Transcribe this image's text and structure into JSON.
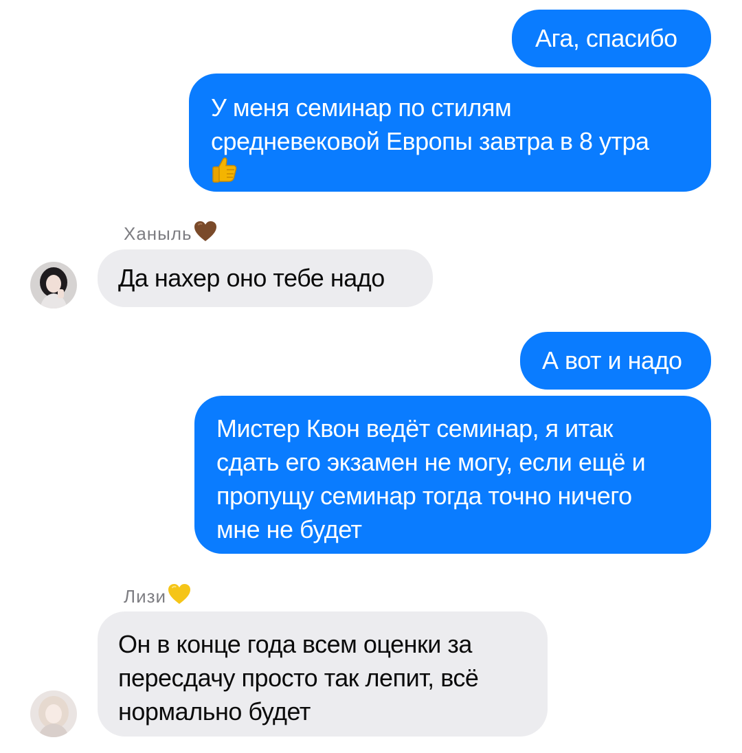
{
  "messages": [
    {
      "id": "m1",
      "direction": "outgoing",
      "text": "Ага, спасибо"
    },
    {
      "id": "m2",
      "direction": "outgoing",
      "line1": "У меня семинар по стилям",
      "line2": "средневековой Европы завтра в 8 утра",
      "emoji": "thumbs-up"
    },
    {
      "id": "m3",
      "direction": "incoming",
      "sender": "Ханыль",
      "sender_emoji": "brown-heart",
      "text": "Да нахер оно тебе надо"
    },
    {
      "id": "m4",
      "direction": "outgoing",
      "text": "А вот и надо"
    },
    {
      "id": "m5",
      "direction": "outgoing",
      "line1": "Мистер Квон ведёт семинар, я итак",
      "line2": "сдать его экзамен не могу, если ещё и",
      "line3": "пропущу семинар тогда точно ничего",
      "line4": "мне не будет"
    },
    {
      "id": "m6",
      "direction": "incoming",
      "sender": "Лизи",
      "sender_emoji": "yellow-heart",
      "line1": "Он в конце года всем оценки за",
      "line2": "пересдачу просто так лепит, всё",
      "line3": "нормально будет"
    }
  ],
  "colors": {
    "outgoing_bubble": "#0a7cff",
    "incoming_bubble": "#ececef",
    "sender_name": "#7d7d82",
    "brown_heart": "#7a4a2a",
    "yellow_heart": "#f5c518"
  }
}
